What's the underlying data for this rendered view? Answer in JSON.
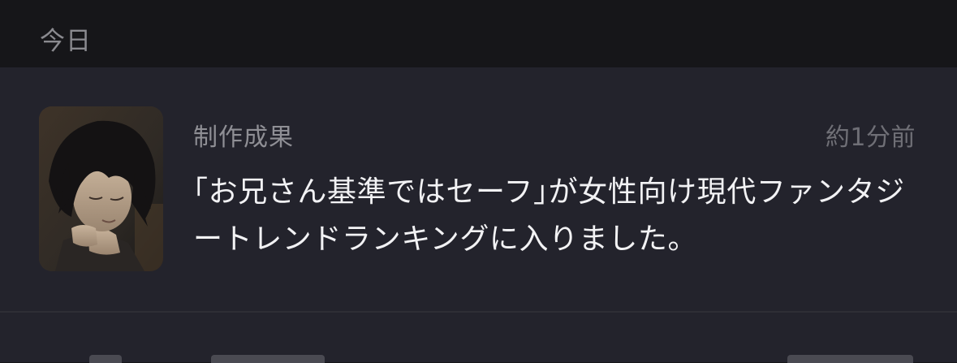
{
  "section": {
    "title": "今日"
  },
  "notification": {
    "category": "制作成果",
    "timestamp": "約1分前",
    "message": "｢お兄さん基準ではセーフ｣が女性向け現代ファンタジートレンドランキングに入りました。",
    "thumbnail_icon": "character-artwork"
  },
  "colors": {
    "background": "#161619",
    "card": "#23232c",
    "text_primary": "#f2f2f4",
    "text_secondary": "#8f8f95"
  }
}
